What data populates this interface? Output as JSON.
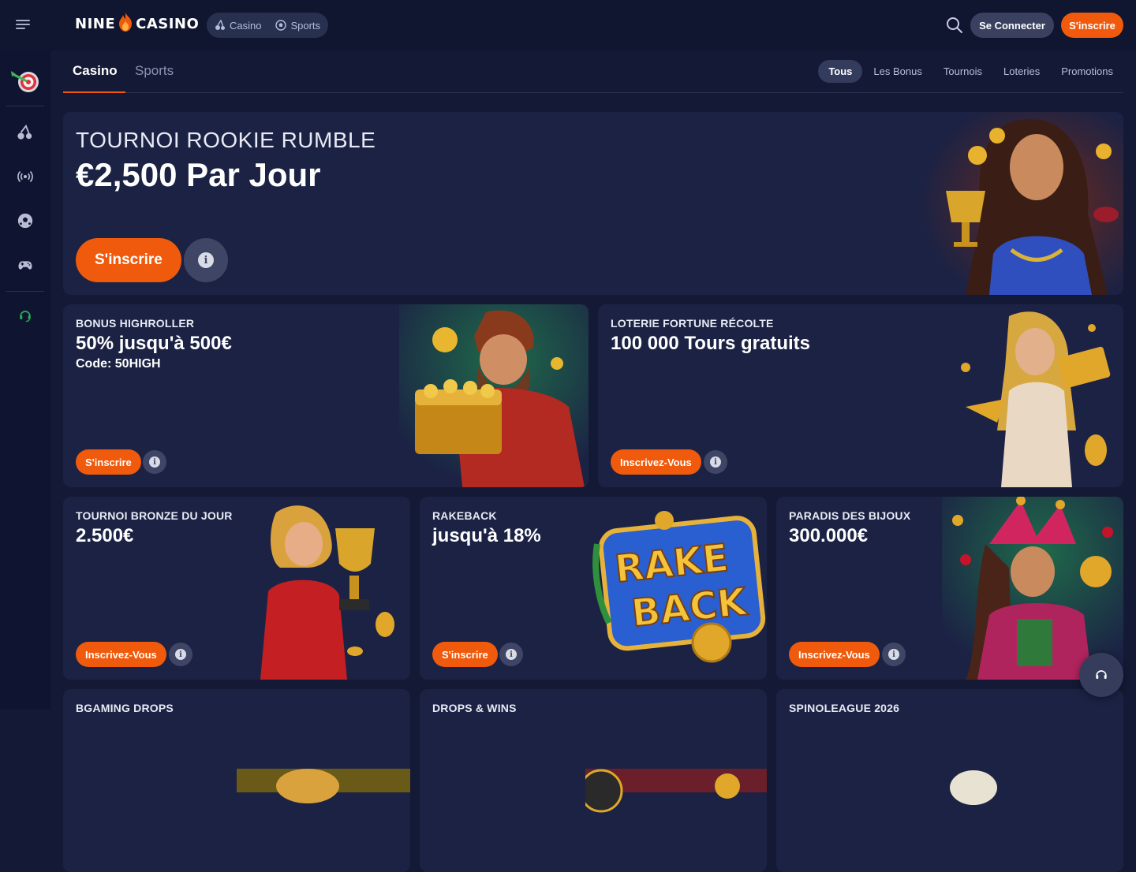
{
  "header": {
    "logo_left": "NINE",
    "logo_right": "CASINO",
    "switch": [
      {
        "label": "Casino",
        "icon": "cherry-icon"
      },
      {
        "label": "Sports",
        "icon": "soccer-ball-icon"
      }
    ],
    "login_label": "Se Connecter",
    "signup_label": "S'inscrire"
  },
  "sidebar": {
    "items": [
      {
        "name": "promotions-target-icon"
      },
      {
        "name": "cherry-icon"
      },
      {
        "name": "live-broadcast-icon"
      },
      {
        "name": "soccer-ball-icon"
      },
      {
        "name": "gamepad-icon"
      },
      {
        "name": "headset-support-icon"
      }
    ]
  },
  "tabs": {
    "main": [
      "Casino",
      "Sports"
    ],
    "filters": [
      "Tous",
      "Les Bonus",
      "Tournois",
      "Loteries",
      "Promotions"
    ],
    "active_filter": "Tous"
  },
  "hero": {
    "eyebrow": "TOURNOI ROOKIE RUMBLE",
    "headline": "€2,500 Par Jour",
    "cta": "S'inscrire"
  },
  "cards": [
    {
      "eyebrow": "BONUS HIGHROLLER",
      "headline": "50% jusqu'à 500€",
      "subline": "Code: 50HIGH",
      "cta": "S'inscrire"
    },
    {
      "eyebrow": "LOTERIE FORTUNE RÉCOLTE",
      "headline": "100 000 Tours gratuits",
      "cta": "Inscrivez-Vous"
    },
    {
      "eyebrow": "TOURNOI BRONZE DU JOUR",
      "headline": "2.500€",
      "cta": "Inscrivez-Vous"
    },
    {
      "eyebrow": "RAKEBACK",
      "headline": "jusqu'à 18%",
      "cta": "S'inscrire",
      "art_text_1": "RAKE",
      "art_text_2": "BACK"
    },
    {
      "eyebrow": "PARADIS DES BIJOUX",
      "headline": "300.000€",
      "cta": "Inscrivez-Vous"
    },
    {
      "eyebrow": "BGAMING DROPS"
    },
    {
      "eyebrow": "DROPS & WINS"
    },
    {
      "eyebrow": "SPINOLEAGUE 2026"
    }
  ],
  "colors": {
    "accent": "#f15a0c",
    "background": "#141a35",
    "card": "#1b2244"
  }
}
